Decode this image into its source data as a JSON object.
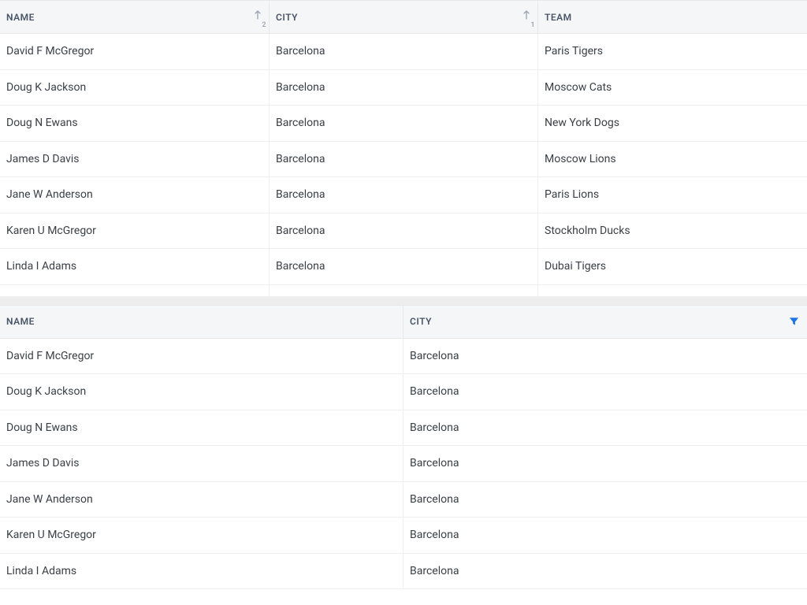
{
  "table1": {
    "columns": [
      {
        "label": "NAME",
        "sort_order": 2
      },
      {
        "label": "CITY",
        "sort_order": 1
      },
      {
        "label": "TEAM"
      }
    ],
    "rows": [
      {
        "name": "David F McGregor",
        "city": "Barcelona",
        "team": "Paris Tigers"
      },
      {
        "name": "Doug K Jackson",
        "city": "Barcelona",
        "team": "Moscow Cats"
      },
      {
        "name": "Doug N Ewans",
        "city": "Barcelona",
        "team": "New York Dogs"
      },
      {
        "name": "James D Davis",
        "city": "Barcelona",
        "team": "Moscow Lions"
      },
      {
        "name": "Jane W Anderson",
        "city": "Barcelona",
        "team": "Paris Lions"
      },
      {
        "name": "Karen U McGregor",
        "city": "Barcelona",
        "team": "Stockholm Ducks"
      },
      {
        "name": "Linda I Adams",
        "city": "Barcelona",
        "team": "Dubai Tigers"
      }
    ]
  },
  "table2": {
    "columns": [
      {
        "label": "NAME"
      },
      {
        "label": "CITY",
        "filter_active": true
      }
    ],
    "rows": [
      {
        "name": "David F McGregor",
        "city": "Barcelona"
      },
      {
        "name": "Doug K Jackson",
        "city": "Barcelona"
      },
      {
        "name": "Doug N Ewans",
        "city": "Barcelona"
      },
      {
        "name": "James D Davis",
        "city": "Barcelona"
      },
      {
        "name": "Jane W Anderson",
        "city": "Barcelona"
      },
      {
        "name": "Karen U McGregor",
        "city": "Barcelona"
      },
      {
        "name": "Linda I Adams",
        "city": "Barcelona"
      }
    ]
  }
}
